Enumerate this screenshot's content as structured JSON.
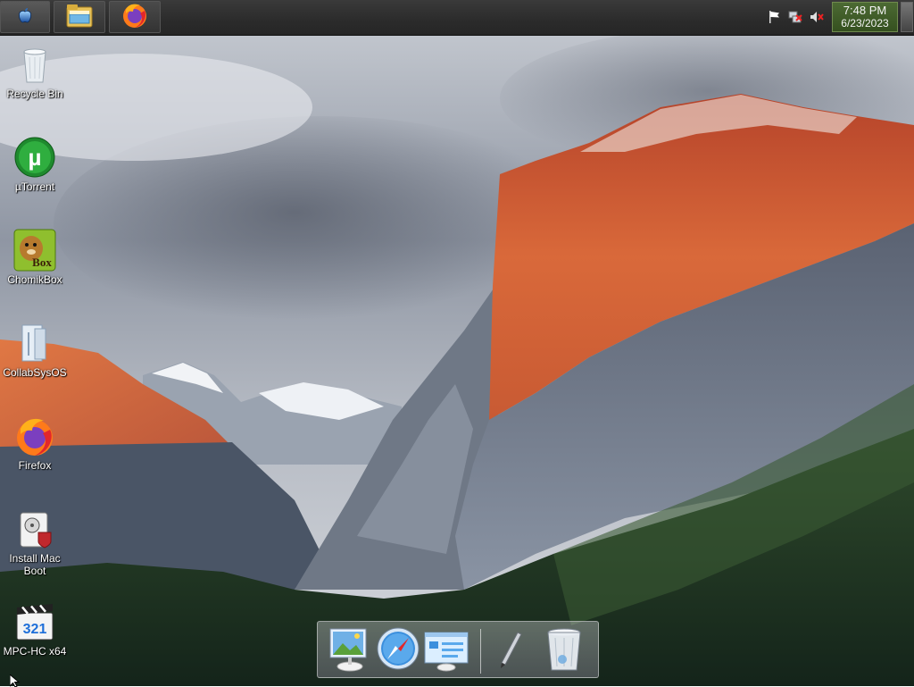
{
  "taskbar": {
    "start_icon": "apple-logo-icon",
    "pinned": [
      {
        "name": "file-explorer",
        "icon": "folder-icon"
      },
      {
        "name": "firefox",
        "icon": "firefox-icon"
      }
    ],
    "tray_icons": [
      "flag-icon",
      "network-icon",
      "volume-muted-icon"
    ],
    "clock": {
      "time": "7:48 PM",
      "date": "6/23/2023"
    }
  },
  "desktop": {
    "icons": [
      {
        "label": "Recycle Bin",
        "icon": "recycle-bin-icon"
      },
      {
        "label": "µTorrent",
        "icon": "utorrent-icon"
      },
      {
        "label": "ChomikBox",
        "icon": "chomikbox-icon"
      },
      {
        "label": "CollabSysOS",
        "icon": "collabsysos-icon"
      },
      {
        "label": "Firefox",
        "icon": "firefox-icon"
      },
      {
        "label": "Install Mac Boot",
        "icon": "install-mac-boot-icon"
      },
      {
        "label": "MPC-HC x64",
        "icon": "mpc-hc-icon"
      }
    ],
    "chomikbox_badge": "Box",
    "mpc_badge": "321"
  },
  "dock": {
    "items": [
      "preview-icon",
      "safari-icon",
      "finder-window-icon",
      "pen-icon",
      "trash-icon"
    ]
  },
  "colors": {
    "taskbar_bg": "#2b2b2b",
    "clock_bg": "#3d5a27",
    "utorrent_green": "#1f8a2e",
    "firefox_orange": "#ff7a1a",
    "firefox_purple": "#7b3fbf"
  }
}
